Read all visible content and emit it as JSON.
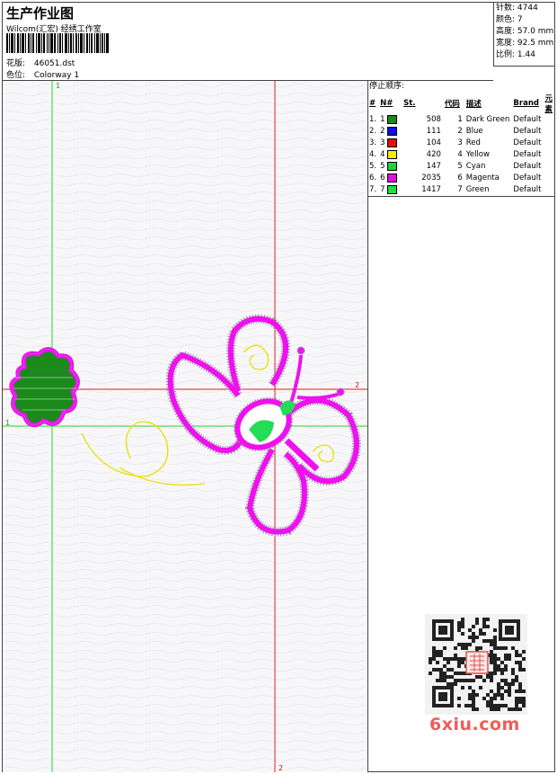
{
  "header": {
    "title": "生产作业图",
    "company": "Wilcom(汇宏) 经绣工作室",
    "design_label": "花版:",
    "design_value": "46051.dst",
    "colorway_label": "色位:",
    "colorway_value": "Colorway 1"
  },
  "stats": {
    "stitches": "针数: 4744",
    "colors": "颜色: 7",
    "height": "高度: 57.0 mm",
    "width": "宽度: 92.5 mm",
    "ratio": "比例: 1.44"
  },
  "stop_sequence": {
    "title": "停止顺序:",
    "columns": [
      "#",
      "N#",
      "St.",
      "代码",
      "描述",
      "Brand",
      "元素"
    ],
    "rows": [
      {
        "idx": "1.",
        "n": "1",
        "color": "#1a8a1a",
        "st": "508",
        "code": "1",
        "desc": "Dark Green",
        "brand": "Default"
      },
      {
        "idx": "2.",
        "n": "2",
        "color": "#1010e0",
        "st": "111",
        "code": "2",
        "desc": "Blue",
        "brand": "Default"
      },
      {
        "idx": "3.",
        "n": "3",
        "color": "#e01010",
        "st": "104",
        "code": "3",
        "desc": "Red",
        "brand": "Default"
      },
      {
        "idx": "4.",
        "n": "4",
        "color": "#f0f000",
        "st": "420",
        "code": "4",
        "desc": "Yellow",
        "brand": "Default"
      },
      {
        "idx": "5.",
        "n": "5",
        "color": "#20d040",
        "st": "147",
        "code": "5",
        "desc": "Cyan",
        "brand": "Default"
      },
      {
        "idx": "6.",
        "n": "6",
        "color": "#e010e0",
        "st": "2035",
        "code": "6",
        "desc": "Magenta",
        "brand": "Default"
      },
      {
        "idx": "7.",
        "n": "7",
        "color": "#20e040",
        "st": "1417",
        "code": "7",
        "desc": "Green",
        "brand": "Default"
      }
    ]
  },
  "guides": {
    "v_green_label": "1",
    "h_green_label": "1",
    "h_red_label": "2",
    "v_red_label": "2"
  },
  "watermark": {
    "text": "6xiu.com"
  }
}
